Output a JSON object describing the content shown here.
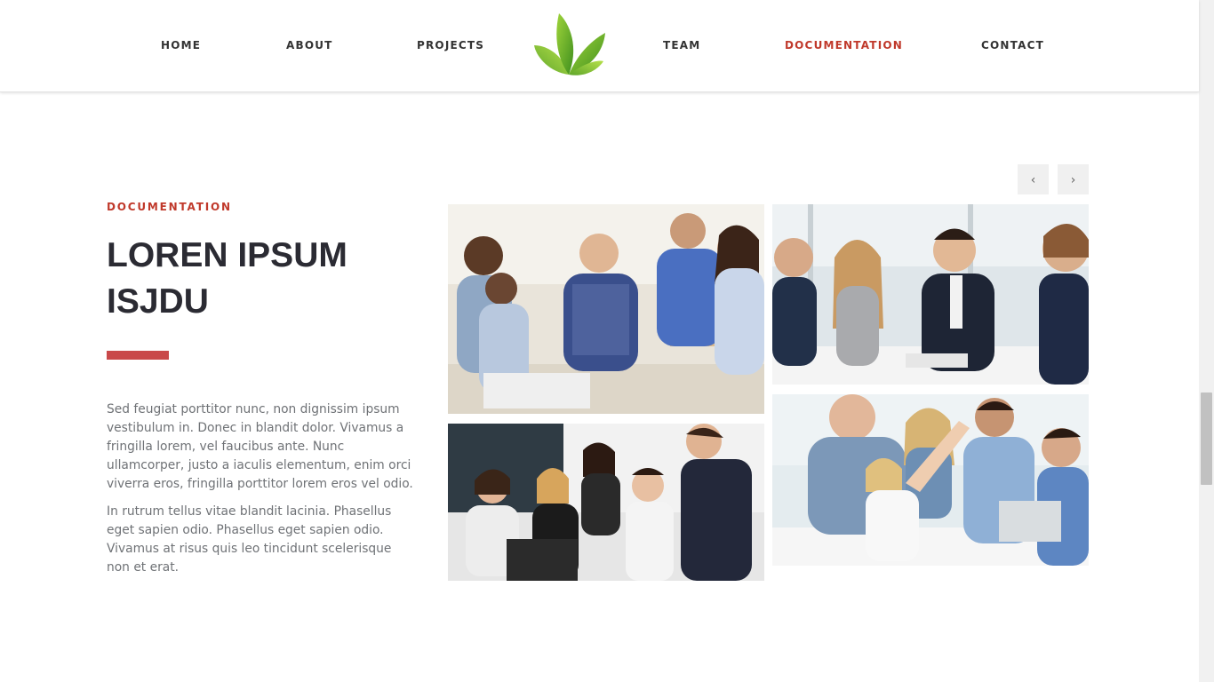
{
  "nav": {
    "items": [
      "HOME",
      "ABOUT",
      "PROJECTS",
      "TEAM",
      "DOCUMENTATION",
      "CONTACT"
    ],
    "active": "DOCUMENTATION",
    "accent_color": "#c0392b",
    "logo_icon": "green-leaves-logo"
  },
  "section": {
    "eyebrow": "DOCUMENTATION",
    "title": "LOREN IPSUM ISJDU",
    "paragraphs": [
      "Sed feugiat porttitor nunc, non dignissim ipsum vestibulum in. Donec in blandit dolor. Vivamus a fringilla lorem, vel faucibus ante. Nunc ullamcorper, justo a iaculis elementum, enim orci viverra eros, fringilla porttitor lorem eros vel odio.",
      "In rutrum tellus vitae blandit lacinia. Phasellus eget sapien odio. Phasellus eget sapien odio. Vivamus at risus quis leo tincidunt scelerisque non et erat."
    ],
    "accent_bar_color": "#c9494a"
  },
  "gallery": {
    "prev_icon": "chevron-left-icon",
    "next_icon": "chevron-right-icon",
    "prev_glyph": "‹",
    "next_glyph": "›"
  }
}
